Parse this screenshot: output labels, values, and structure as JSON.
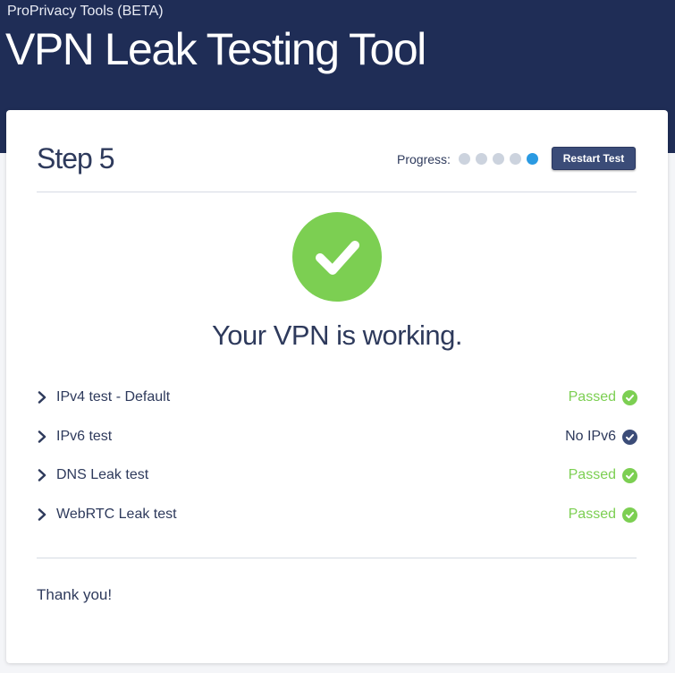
{
  "header": {
    "subtitle": "ProPrivacy Tools (BETA)",
    "title": "VPN Leak Testing Tool"
  },
  "card": {
    "step_title": "Step 5",
    "progress_label": "Progress:",
    "progress": {
      "total_steps": 5,
      "current_step": 5
    },
    "restart_label": "Restart Test",
    "headline": "Your VPN is working.",
    "tests": [
      {
        "name": "IPv4 test - Default",
        "status": "Passed",
        "status_type": "pass"
      },
      {
        "name": "IPv6 test",
        "status": "No IPv6",
        "status_type": "info"
      },
      {
        "name": "DNS Leak test",
        "status": "Passed",
        "status_type": "pass"
      },
      {
        "name": "WebRTC Leak test",
        "status": "Passed",
        "status_type": "pass"
      }
    ],
    "footer_text": "Thank you!"
  },
  "icons": {
    "result": "checkmark-circle-icon",
    "expand": "chevron-right-icon",
    "status": "check-circle-icon"
  },
  "colors": {
    "header_bg": "#1f2d56",
    "pass_green": "#7ccf52",
    "active_dot": "#2a9ae2",
    "button_bg": "#3b4c78",
    "text_dark": "#2e3a5c"
  }
}
